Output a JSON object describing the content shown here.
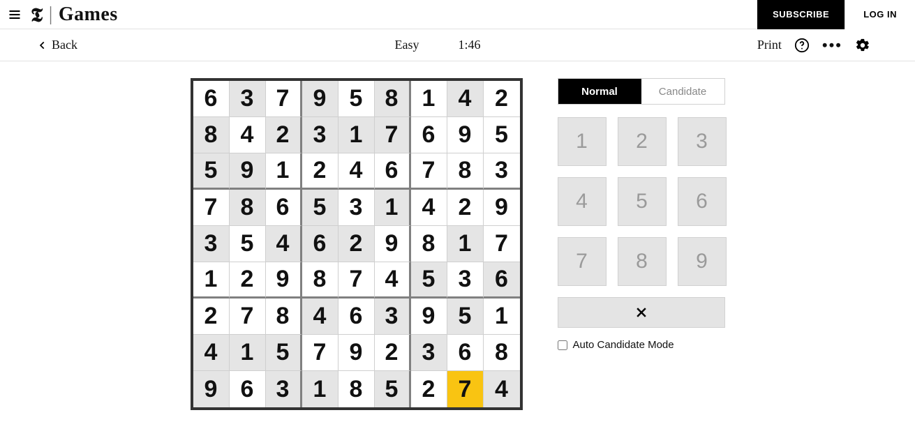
{
  "header": {
    "brand_logo": "𝕿",
    "brand_divider": "|",
    "brand_name": "Games",
    "subscribe_label": "SUBSCRIBE",
    "login_label": "LOG IN"
  },
  "toolbar": {
    "back_label": "Back",
    "difficulty": "Easy",
    "timer": "1:46",
    "print_label": "Print"
  },
  "mode": {
    "normal_label": "Normal",
    "candidate_label": "Candidate",
    "active": "normal"
  },
  "numpad": [
    "1",
    "2",
    "3",
    "4",
    "5",
    "6",
    "7",
    "8",
    "9"
  ],
  "auto_candidate_label": "Auto Candidate Mode",
  "auto_candidate_checked": false,
  "selected_cell": {
    "row": 8,
    "col": 7
  },
  "grid": [
    [
      {
        "v": "6",
        "g": false
      },
      {
        "v": "3",
        "g": true
      },
      {
        "v": "7",
        "g": false
      },
      {
        "v": "9",
        "g": true
      },
      {
        "v": "5",
        "g": false
      },
      {
        "v": "8",
        "g": true
      },
      {
        "v": "1",
        "g": false
      },
      {
        "v": "4",
        "g": true
      },
      {
        "v": "2",
        "g": false
      }
    ],
    [
      {
        "v": "8",
        "g": true
      },
      {
        "v": "4",
        "g": false
      },
      {
        "v": "2",
        "g": true
      },
      {
        "v": "3",
        "g": true
      },
      {
        "v": "1",
        "g": true
      },
      {
        "v": "7",
        "g": true
      },
      {
        "v": "6",
        "g": false
      },
      {
        "v": "9",
        "g": false
      },
      {
        "v": "5",
        "g": false
      }
    ],
    [
      {
        "v": "5",
        "g": true
      },
      {
        "v": "9",
        "g": true
      },
      {
        "v": "1",
        "g": false
      },
      {
        "v": "2",
        "g": false
      },
      {
        "v": "4",
        "g": false
      },
      {
        "v": "6",
        "g": false
      },
      {
        "v": "7",
        "g": false
      },
      {
        "v": "8",
        "g": false
      },
      {
        "v": "3",
        "g": false
      }
    ],
    [
      {
        "v": "7",
        "g": false
      },
      {
        "v": "8",
        "g": true
      },
      {
        "v": "6",
        "g": false
      },
      {
        "v": "5",
        "g": true
      },
      {
        "v": "3",
        "g": false
      },
      {
        "v": "1",
        "g": true
      },
      {
        "v": "4",
        "g": false
      },
      {
        "v": "2",
        "g": false
      },
      {
        "v": "9",
        "g": false
      }
    ],
    [
      {
        "v": "3",
        "g": true
      },
      {
        "v": "5",
        "g": false
      },
      {
        "v": "4",
        "g": true
      },
      {
        "v": "6",
        "g": true
      },
      {
        "v": "2",
        "g": true
      },
      {
        "v": "9",
        "g": false
      },
      {
        "v": "8",
        "g": false
      },
      {
        "v": "1",
        "g": true
      },
      {
        "v": "7",
        "g": false
      }
    ],
    [
      {
        "v": "1",
        "g": false
      },
      {
        "v": "2",
        "g": false
      },
      {
        "v": "9",
        "g": false
      },
      {
        "v": "8",
        "g": false
      },
      {
        "v": "7",
        "g": false
      },
      {
        "v": "4",
        "g": false
      },
      {
        "v": "5",
        "g": true
      },
      {
        "v": "3",
        "g": false
      },
      {
        "v": "6",
        "g": true
      }
    ],
    [
      {
        "v": "2",
        "g": false
      },
      {
        "v": "7",
        "g": false
      },
      {
        "v": "8",
        "g": false
      },
      {
        "v": "4",
        "g": true
      },
      {
        "v": "6",
        "g": false
      },
      {
        "v": "3",
        "g": true
      },
      {
        "v": "9",
        "g": false
      },
      {
        "v": "5",
        "g": true
      },
      {
        "v": "1",
        "g": false
      }
    ],
    [
      {
        "v": "4",
        "g": true
      },
      {
        "v": "1",
        "g": true
      },
      {
        "v": "5",
        "g": true
      },
      {
        "v": "7",
        "g": false
      },
      {
        "v": "9",
        "g": false
      },
      {
        "v": "2",
        "g": false
      },
      {
        "v": "3",
        "g": true
      },
      {
        "v": "6",
        "g": false
      },
      {
        "v": "8",
        "g": false
      }
    ],
    [
      {
        "v": "9",
        "g": true
      },
      {
        "v": "6",
        "g": false
      },
      {
        "v": "3",
        "g": true
      },
      {
        "v": "1",
        "g": true
      },
      {
        "v": "8",
        "g": false
      },
      {
        "v": "5",
        "g": true
      },
      {
        "v": "2",
        "g": false
      },
      {
        "v": "7",
        "g": false
      },
      {
        "v": "4",
        "g": true
      }
    ]
  ]
}
